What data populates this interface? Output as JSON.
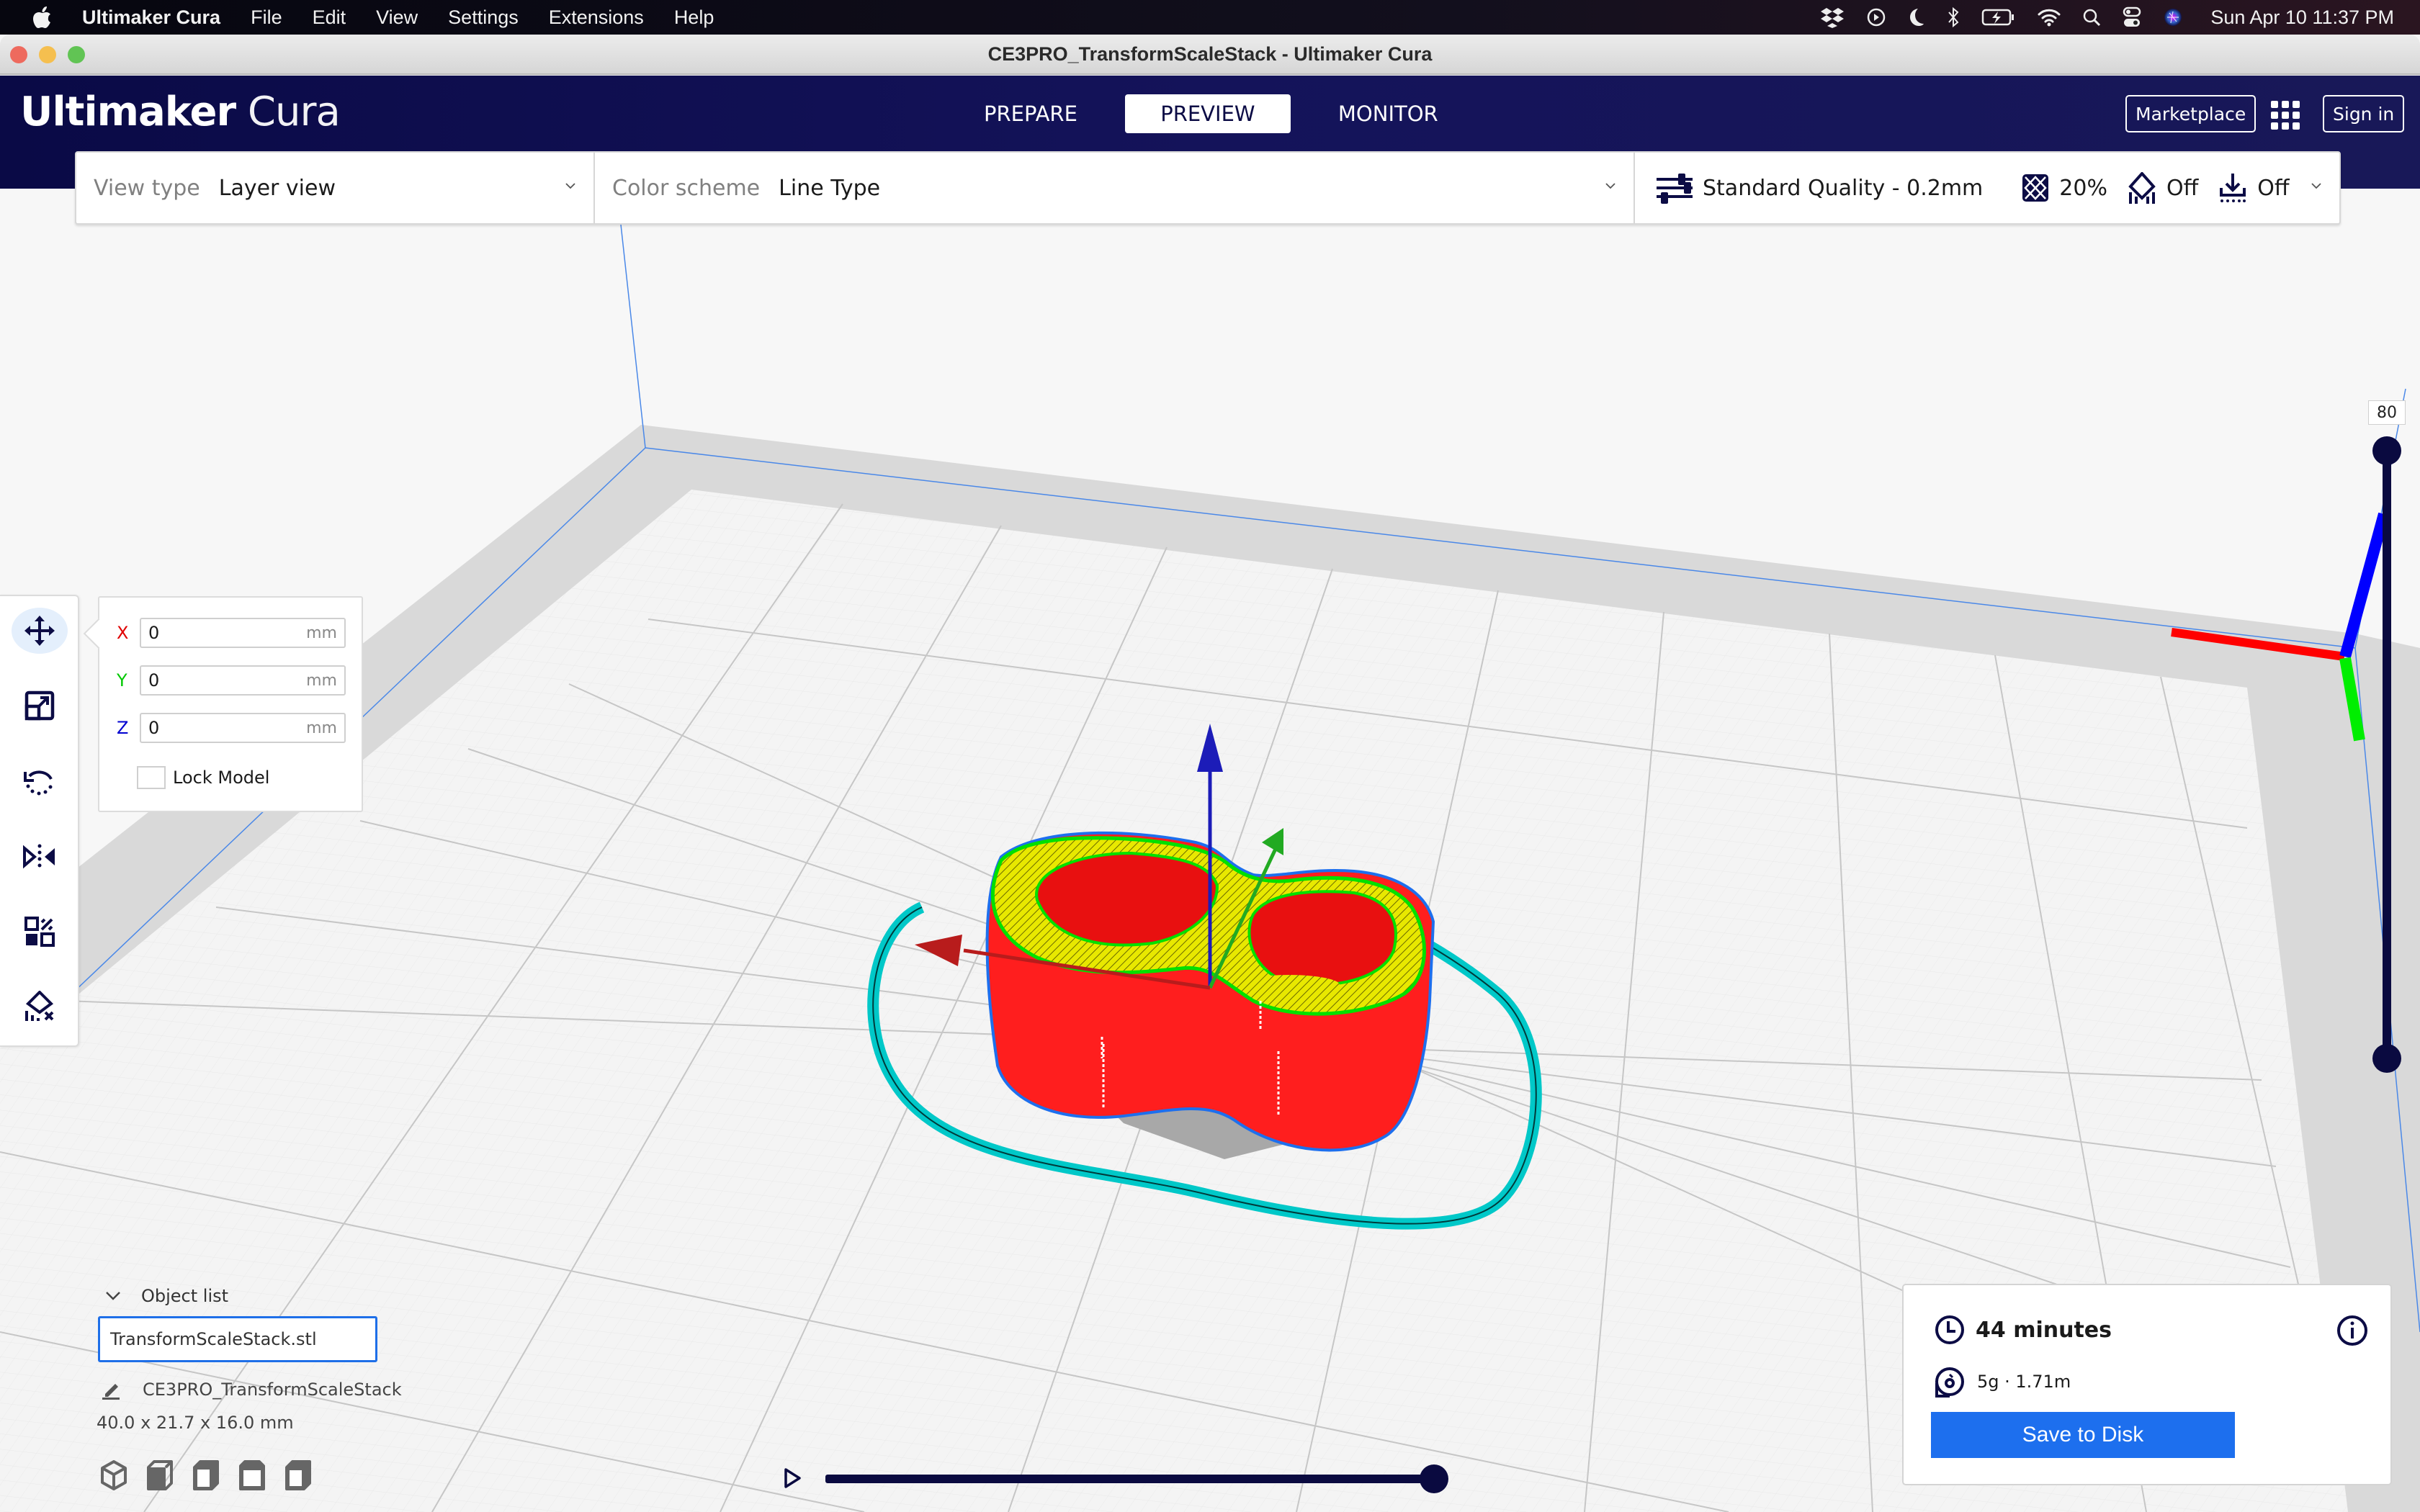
{
  "menubar": {
    "app_name": "Ultimaker Cura",
    "items": [
      "File",
      "Edit",
      "View",
      "Settings",
      "Extensions",
      "Help"
    ],
    "status_icons": [
      "dropbox-icon",
      "play-circle-icon",
      "moon-icon",
      "bluetooth-icon",
      "battery-charging-icon",
      "wifi-icon",
      "spotlight-search-icon",
      "control-center-icon",
      "siri-icon"
    ],
    "clock": "Sun Apr 10  11:37 PM"
  },
  "window": {
    "title": "CE3PRO_TransformScaleStack - Ultimaker Cura"
  },
  "header": {
    "logo_bold": "Ultimaker",
    "logo_light": "Cura",
    "tabs": [
      {
        "label": "PREPARE",
        "active": false
      },
      {
        "label": "PREVIEW",
        "active": true
      },
      {
        "label": "MONITOR",
        "active": false
      }
    ],
    "marketplace_label": "Marketplace",
    "signin_label": "Sign in"
  },
  "viewbar": {
    "view_type_label": "View type",
    "view_type_value": "Layer view",
    "color_scheme_label": "Color scheme",
    "color_scheme_value": "Line Type",
    "quality": "Standard Quality - 0.2mm",
    "infill": "20%",
    "support": "Off",
    "adhesion": "Off"
  },
  "move_panel": {
    "x_label": "X",
    "x_value": "0",
    "y_label": "Y",
    "y_value": "0",
    "z_label": "Z",
    "z_value": "0",
    "unit": "mm",
    "lock_model_label": "Lock Model",
    "lock_model_checked": false
  },
  "tools": [
    "move",
    "scale",
    "rotate",
    "mirror",
    "per-model-settings",
    "support-blocker"
  ],
  "object_list": {
    "header": "Object list",
    "selected_object": "TransformScaleStack.stl",
    "job_name": "CE3PRO_TransformScaleStack",
    "dimensions": "40.0 x 21.7 x 16.0 mm"
  },
  "camera_views": [
    "3d-view",
    "front-view",
    "top-view",
    "left-view",
    "right-view"
  ],
  "print_summary": {
    "time": "44 minutes",
    "material": "5g · 1.71m",
    "save_label": "Save to Disk"
  },
  "layer_slider": {
    "current_layer": "80",
    "upper_fraction": 1.0,
    "lower_fraction": 0.0
  },
  "path_slider": {
    "progress_fraction": 1.0
  },
  "colors": {
    "header_bg": "#0f0e4e",
    "accent_blue": "#1d6fee",
    "slider_dark": "#0a0a40",
    "outer_wall": "#ff1a1a",
    "inner_wall": "#00e000",
    "skin": "#e6e600",
    "skirt": "#00d4d4"
  }
}
